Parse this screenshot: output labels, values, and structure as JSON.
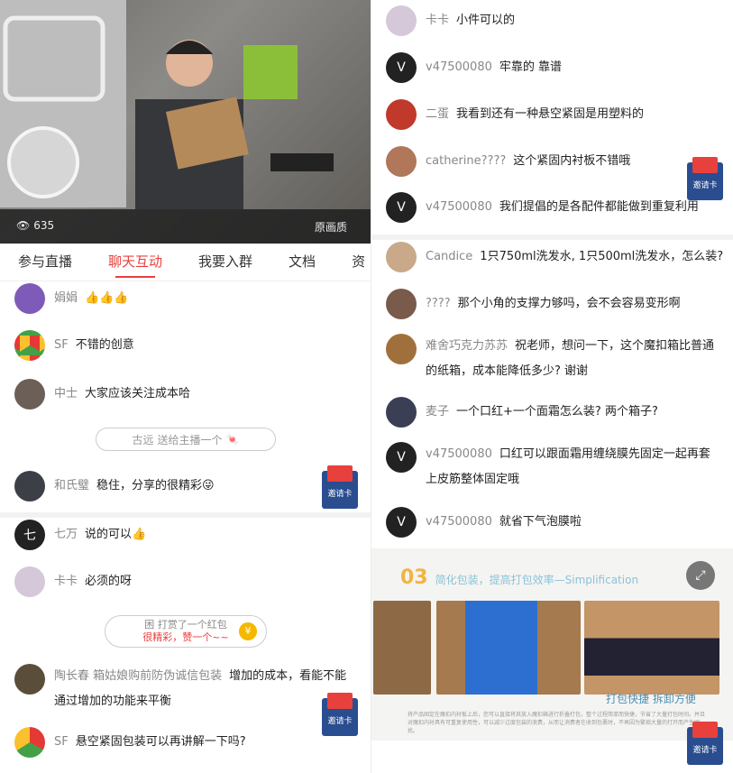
{
  "video": {
    "viewers": "635",
    "quality_label": "原画质"
  },
  "tabs": [
    "参与直播",
    "聊天互动",
    "我要入群",
    "文档",
    "资"
  ],
  "left_chat": [
    {
      "user": "娟娟",
      "text": "👍👍👍",
      "avatar": "purple-avatar"
    },
    {
      "user": "SF",
      "text": "不错的创意",
      "avatar": "chrome-avatar"
    },
    {
      "user": "中士",
      "text": "大家应该关注成本哈",
      "avatar": "photo-avatar"
    },
    {
      "user": "和氏璧",
      "text": "稳住，分享的很精彩😜",
      "avatar": "photo-avatar"
    },
    {
      "user": "七万",
      "text": "说的可以👍",
      "avatar": "letter-avatar",
      "initial": "七"
    },
    {
      "user": "卡卡",
      "text": "必须的呀",
      "avatar": "cartoon-avatar"
    },
    {
      "user": "陶长春 箱姑娘购前防伪诚信包装",
      "text": "增加的成本，看能不能通过增加的功能来平衡",
      "avatar": "photo-avatar"
    },
    {
      "user": "SF",
      "text": "悬空紧固包装可以再讲解一下吗?",
      "avatar": "chrome-avatar"
    }
  ],
  "system_gift": {
    "user": "古远",
    "text": "送给主播一个"
  },
  "system_redpack": {
    "line1": "困 打赏了一个红包",
    "line2": "很精彩，赞一个~~",
    "coin": "¥"
  },
  "invite_label": "邀请卡",
  "right_chat": [
    {
      "user": "卡卡",
      "text": "小件可以的",
      "avatar": "cartoon-avatar"
    },
    {
      "user": "v47500080",
      "text": "牢靠的 靠谱",
      "avatar": "letter-avatar",
      "initial": "V"
    },
    {
      "user": "二蛋",
      "text": "我看到还有一种悬空紧固是用塑料的",
      "avatar": "photo-avatar"
    },
    {
      "user": "catherine????",
      "text": "这个紧固内衬板不错哦",
      "avatar": "photo-avatar"
    },
    {
      "user": "v47500080",
      "text": "我们提倡的是各配件都能做到重复利用",
      "avatar": "letter-avatar",
      "initial": "V"
    },
    {
      "user": "Candice",
      "text": "1只750ml洗发水, 1只500ml洗发水，怎么装?",
      "avatar": "photo-avatar"
    },
    {
      "user": "????",
      "text": "那个小角的支撑力够吗，会不会容易变形啊",
      "avatar": "photo-avatar"
    },
    {
      "user": "难舍巧克力苏苏",
      "text": "祝老师，想问一下，这个魔扣箱比普通的纸箱，成本能降低多少? 谢谢",
      "avatar": "bear-avatar"
    },
    {
      "user": "麦子",
      "text": "一个口红+一个面霜怎么装? 两个箱子?",
      "avatar": "photo-avatar"
    },
    {
      "user": "v47500080",
      "text": "口红可以跟面霜用缠绕膜先固定一起再套上皮筋整体固定哦",
      "avatar": "letter-avatar",
      "initial": "V"
    },
    {
      "user": "v47500080",
      "text": "就省下气泡膜啦",
      "avatar": "letter-avatar",
      "initial": "V"
    }
  ],
  "promo": {
    "number": "03",
    "title": "简化包装，提高打包效率—Simplification",
    "caption": "打包快捷 拆卸方便",
    "body": "将产品固定在魔扣内衬板上后，您可以直接将其放入魔扣箱进行折叠打包，整个过程简单而快捷，节省了大量打包时间。并且对魔扣内衬具有可重复使用性，可以减少过度包装的浪费，从而让消费者在收到包裹时，不再因为繁琐大量的打开而产生困扰。"
  }
}
